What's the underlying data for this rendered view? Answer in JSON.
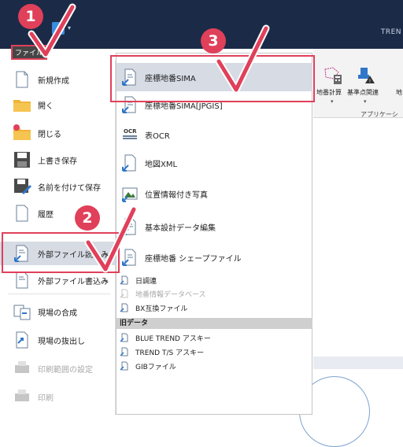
{
  "app": {
    "title": "TREN",
    "file_tab": "ファイル"
  },
  "ribbon": {
    "buttons": [
      {
        "label": "地番計算",
        "icon": "lot-calc-icon"
      },
      {
        "label": "基準点関連",
        "icon": "control-point-icon"
      },
      {
        "label": "地",
        "icon": "partial-icon"
      }
    ],
    "group_label": "アプリケーシ"
  },
  "file_menu": {
    "items": [
      {
        "label": "新規作成",
        "icon": "new-document-icon"
      },
      {
        "label": "開く",
        "icon": "open-folder-icon"
      },
      {
        "label": "閉じる",
        "icon": "close-folder-icon"
      },
      {
        "label": "上書き保存",
        "icon": "save-icon"
      },
      {
        "label": "名前を付けて保存",
        "icon": "save-as-icon"
      },
      {
        "label": "履歴",
        "icon": "history-icon"
      },
      {
        "label": "外部ファイル読込み",
        "icon": "import-file-icon",
        "submenu": true
      },
      {
        "label": "外部ファイル書込み",
        "icon": "export-file-icon",
        "submenu": true
      },
      {
        "label": "現場の合成",
        "icon": "merge-site-icon"
      },
      {
        "label": "現場の抜出し",
        "icon": "extract-site-icon"
      },
      {
        "label": "印刷範囲の設定",
        "icon": "print-range-icon",
        "disabled": true
      },
      {
        "label": "印刷",
        "icon": "print-icon",
        "disabled": true
      }
    ]
  },
  "import_submenu": {
    "items": [
      {
        "label": "座標地番SIMA",
        "icon": "sima-icon"
      },
      {
        "label": "座標地番SIMA[JPGIS]",
        "icon": "sima-jpgis-icon"
      },
      {
        "label": "表OCR",
        "icon": "ocr-icon",
        "icon_text": "OCR"
      },
      {
        "label": "地図XML",
        "icon": "xml-icon"
      },
      {
        "label": "位置情報付き写真",
        "icon": "geotag-photo-icon"
      },
      {
        "label": "基本設計データ編集",
        "icon": "design-data-icon"
      },
      {
        "label": "座標地番 シェープファイル",
        "icon": "shapefile-icon"
      }
    ],
    "small_items": [
      {
        "label": "日調連",
        "icon": "nichoren-icon",
        "disabled": false
      },
      {
        "label": "地番情報データベース",
        "icon": "lot-db-icon",
        "disabled": true
      },
      {
        "label": "BX互換ファイル",
        "icon": "bx-icon",
        "disabled": false
      }
    ],
    "old_header": "旧データ",
    "old_items": [
      {
        "label": "BLUE TREND アスキー",
        "icon": "blue-trend-icon"
      },
      {
        "label": "TREND T/S アスキー",
        "icon": "trend-ts-icon"
      },
      {
        "label": "GIBファイル",
        "icon": "gib-icon"
      }
    ]
  },
  "callouts": [
    {
      "number": "1"
    },
    {
      "number": "2"
    },
    {
      "number": "3"
    }
  ],
  "colors": {
    "accent": "#e0405a",
    "titlebar": "#1b2b47",
    "hover": "#d6dbe4"
  }
}
